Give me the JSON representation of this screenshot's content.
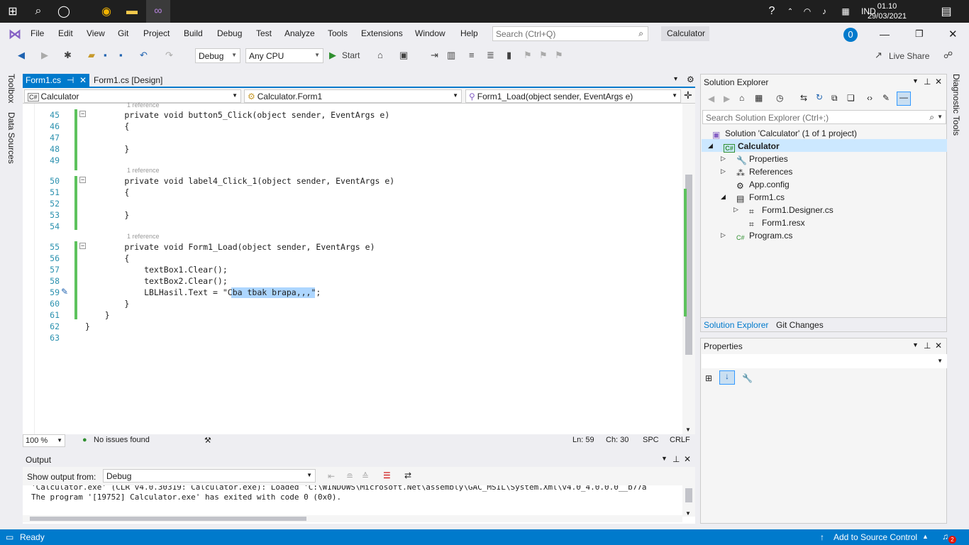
{
  "taskbar": {
    "clock_time": "01.10",
    "clock_date": "29/03/2021",
    "language": "IND"
  },
  "menu": {
    "items": [
      "File",
      "Edit",
      "View",
      "Git",
      "Project",
      "Build",
      "Debug",
      "Test",
      "Analyze",
      "Tools",
      "Extensions",
      "Window",
      "Help"
    ],
    "search_placeholder": "Search (Ctrl+Q)",
    "solution_badge": "Calculator",
    "notification_count": "0"
  },
  "toolbar": {
    "config": "Debug",
    "platform": "Any CPU",
    "start_label": "Start",
    "live_share": "Live Share"
  },
  "side_tabs": {
    "left": [
      "Toolbox",
      "Data Sources"
    ],
    "right": "Diagnostic Tools"
  },
  "doc_tabs": {
    "active": "Form1.cs",
    "second": "Form1.cs [Design]"
  },
  "nav": {
    "project": "Calculator",
    "class": "Calculator.Form1",
    "member": "Form1_Load(object sender, EventArgs e)"
  },
  "code": {
    "ref_label": "1 reference",
    "lines": [
      {
        "n": "45",
        "t": "        private void button5_Click(object sender, EventArgs e)"
      },
      {
        "n": "46",
        "t": "        {"
      },
      {
        "n": "47",
        "t": ""
      },
      {
        "n": "48",
        "t": "        }"
      },
      {
        "n": "49",
        "t": ""
      },
      {
        "n": "50",
        "t": "        private void label4_Click_1(object sender, EventArgs e)"
      },
      {
        "n": "51",
        "t": "        {"
      },
      {
        "n": "52",
        "t": ""
      },
      {
        "n": "53",
        "t": "        }"
      },
      {
        "n": "54",
        "t": ""
      },
      {
        "n": "55",
        "t": "        private void Form1_Load(object sender, EventArgs e)"
      },
      {
        "n": "56",
        "t": "        {"
      },
      {
        "n": "57",
        "t": "            textBox1.Clear();"
      },
      {
        "n": "58",
        "t": "            textBox2.Clear();"
      },
      {
        "n": "59",
        "t": "            LBLHasil.Text = \"Cba tbak brapa,,,\";"
      },
      {
        "n": "60",
        "t": "        }"
      },
      {
        "n": "61",
        "t": "    }"
      },
      {
        "n": "62",
        "t": "}"
      },
      {
        "n": "63",
        "t": ""
      }
    ],
    "selected_text": "Cba tbak brapa,,,"
  },
  "edit_status": {
    "zoom": "100 %",
    "issues": "No issues found",
    "ln": "Ln: 59",
    "ch": "Ch: 30",
    "spc": "SPC",
    "crlf": "CRLF"
  },
  "output": {
    "title": "Output",
    "show_from_label": "Show output from:",
    "source": "Debug",
    "line1": "'Calculator.exe' (CLR v4.0.30319: Calculator.exe): Loaded 'C:\\WINDOWS\\Microsoft.Net\\assembly\\GAC_MSIL\\System.Xml\\v4.0_4.0.0.0__b77a",
    "line2": "The program '[19752] Calculator.exe' has exited with code 0 (0x0)."
  },
  "solution_explorer": {
    "title": "Solution Explorer",
    "search_placeholder": "Search Solution Explorer (Ctrl+;)",
    "solution": "Solution 'Calculator' (1 of 1 project)",
    "project": "Calculator",
    "items": [
      "Properties",
      "References",
      "App.config",
      "Form1.cs",
      "Form1.Designer.cs",
      "Form1.resx",
      "Program.cs"
    ],
    "tab_solution": "Solution Explorer",
    "tab_git": "Git Changes"
  },
  "properties": {
    "title": "Properties"
  },
  "status": {
    "ready": "Ready",
    "source_control": "Add to Source Control",
    "bell_count": "2"
  }
}
